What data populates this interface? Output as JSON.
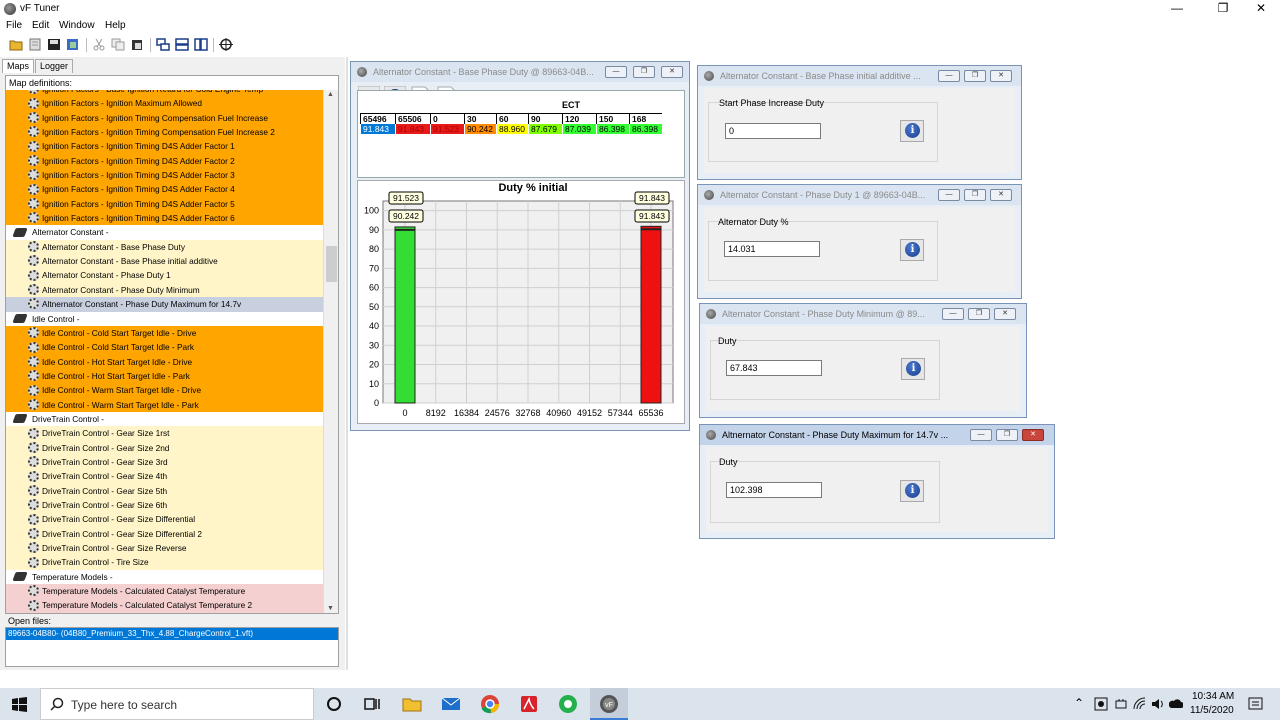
{
  "app": {
    "title": "vF Tuner"
  },
  "menu": {
    "file": "File",
    "edit": "Edit",
    "window": "Window",
    "help": "Help"
  },
  "left": {
    "tab_maps": "Maps",
    "tab_logger": "Logger",
    "caption": "Map definitions:",
    "open_files_label": "Open files:",
    "open_file": "89663-04B80- (04B80_Premium_33_Thx_4.88_ChargeControl_1.vft)"
  },
  "tree": [
    {
      "kind": "child",
      "style": "cat-orange",
      "label": "Ignition Factors - Base Ignition Retard for Cold Engine Temp"
    },
    {
      "kind": "child",
      "style": "cat-orange",
      "label": "Ignition Factors - Ignition Maximum Allowed"
    },
    {
      "kind": "child",
      "style": "cat-orange",
      "label": "Ignition Factors - Ignition Timing Compensation Fuel Increase"
    },
    {
      "kind": "child",
      "style": "cat-orange",
      "label": "Ignition Factors - Ignition Timing Compensation Fuel Increase 2"
    },
    {
      "kind": "child",
      "style": "cat-orange",
      "label": "Ignition Factors - Ignition Timing D4S Adder Factor 1"
    },
    {
      "kind": "child",
      "style": "cat-orange",
      "label": "Ignition Factors - Ignition Timing D4S Adder Factor 2"
    },
    {
      "kind": "child",
      "style": "cat-orange",
      "label": "Ignition Factors - Ignition Timing D4S Adder Factor 3"
    },
    {
      "kind": "child",
      "style": "cat-orange",
      "label": "Ignition Factors - Ignition Timing D4S Adder Factor 4"
    },
    {
      "kind": "child",
      "style": "cat-orange",
      "label": "Ignition Factors - Ignition Timing D4S Adder Factor 5"
    },
    {
      "kind": "child",
      "style": "cat-orange",
      "label": "Ignition Factors - Ignition Timing D4S Adder Factor 6"
    },
    {
      "kind": "group",
      "style": "group",
      "label": "Alternator Constant -"
    },
    {
      "kind": "child",
      "style": "cat-yellow",
      "label": "Alternator Constant - Base Phase Duty"
    },
    {
      "kind": "child",
      "style": "cat-yellow",
      "label": "Alternator Constant - Base Phase initial additive"
    },
    {
      "kind": "child",
      "style": "cat-yellow",
      "label": "Alternator Constant - Phase Duty 1"
    },
    {
      "kind": "child",
      "style": "cat-yellow",
      "label": "Alternator Constant - Phase Duty Minimum"
    },
    {
      "kind": "child",
      "style": "cat-sel",
      "label": "Altnernator Constant - Phase Duty Maximum for 14.7v"
    },
    {
      "kind": "group",
      "style": "group",
      "label": "Idle Control -"
    },
    {
      "kind": "child",
      "style": "cat-orange",
      "label": "Idle Control - Cold Start Target Idle - Drive"
    },
    {
      "kind": "child",
      "style": "cat-orange",
      "label": "Idle Control - Cold Start Target Idle - Park"
    },
    {
      "kind": "child",
      "style": "cat-orange",
      "label": "Idle Control - Hot Start Target Idle - Drive"
    },
    {
      "kind": "child",
      "style": "cat-orange",
      "label": "Idle Control - Hot Start Target Idle - Park"
    },
    {
      "kind": "child",
      "style": "cat-orange",
      "label": "Idle Control - Warm Start Target Idle - Drive"
    },
    {
      "kind": "child",
      "style": "cat-orange",
      "label": "Idle Control - Warm Start Target Idle - Park"
    },
    {
      "kind": "group",
      "style": "group",
      "label": "DriveTrain Control -"
    },
    {
      "kind": "child",
      "style": "cat-yellow",
      "label": "DriveTrain Control - Gear Size 1rst"
    },
    {
      "kind": "child",
      "style": "cat-yellow",
      "label": "DriveTrain Control - Gear Size 2nd"
    },
    {
      "kind": "child",
      "style": "cat-yellow",
      "label": "DriveTrain Control - Gear Size 3rd"
    },
    {
      "kind": "child",
      "style": "cat-yellow",
      "label": "DriveTrain Control - Gear Size 4th"
    },
    {
      "kind": "child",
      "style": "cat-yellow",
      "label": "DriveTrain Control - Gear Size 5th"
    },
    {
      "kind": "child",
      "style": "cat-yellow",
      "label": "DriveTrain Control - Gear Size 6th"
    },
    {
      "kind": "child",
      "style": "cat-yellow",
      "label": "DriveTrain Control - Gear Size Differential"
    },
    {
      "kind": "child",
      "style": "cat-yellow",
      "label": "DriveTrain Control - Gear Size Differential 2"
    },
    {
      "kind": "child",
      "style": "cat-yellow",
      "label": "DriveTrain Control - Gear Size Reverse"
    },
    {
      "kind": "child",
      "style": "cat-yellow",
      "label": "DriveTrain Control - Tire Size"
    },
    {
      "kind": "group",
      "style": "group",
      "label": "Temperature Models -"
    },
    {
      "kind": "child",
      "style": "cat-pink",
      "label": "Temperature Models - Calculated Catalyst Temperature"
    },
    {
      "kind": "child",
      "style": "cat-pink",
      "label": "Temperature Models - Calculated Catalyst Temperature 2"
    }
  ],
  "win_base": {
    "title": "Alternator Constant - Base Phase Duty @ 89663-04B...",
    "axis_title": "ECT",
    "chart_title": "Duty % initial",
    "axis": [
      "65496",
      "65506",
      "0",
      "30",
      "60",
      "90",
      "120",
      "150",
      "168"
    ],
    "values": [
      "91.843",
      "91.843",
      "91.523",
      "90.242",
      "88.960",
      "87.679",
      "87.039",
      "86.398",
      "86.398"
    ],
    "value_colors": [
      "#0078d7",
      "#e81b1b",
      "#e81b1b",
      "#ff8c00",
      "#ffff00",
      "#7fff00",
      "#33ff33",
      "#33ff33",
      "#33ff33"
    ]
  },
  "chart_data": {
    "type": "bar",
    "title": "Duty % initial",
    "xlabel": "",
    "ylabel": "",
    "x_ticks": [
      "0",
      "8192",
      "16384",
      "24576",
      "32768",
      "40960",
      "49152",
      "57344",
      "65536"
    ],
    "y_ticks": [
      "0",
      "10",
      "20",
      "30",
      "40",
      "50",
      "60",
      "70",
      "80",
      "90",
      "100"
    ],
    "ylim": [
      0,
      105
    ],
    "bars": [
      {
        "x": 0,
        "value": 91.523,
        "color": "#33dd33",
        "labels": [
          "91.523",
          "90.242"
        ]
      },
      {
        "x": 65536,
        "value": 91.843,
        "color": "#ee1111",
        "labels": [
          "91.843",
          "91.843"
        ]
      }
    ]
  },
  "win_additive": {
    "title": "Alternator Constant - Base Phase initial additive ...",
    "group": "Start Phase Increase Duty",
    "value": "0"
  },
  "win_phase1": {
    "title": "Alternator Constant - Phase Duty 1 @ 89663-04B...",
    "group": "Alternator Duty %",
    "value": "14.031"
  },
  "win_min": {
    "title": "Alternator Constant - Phase Duty Minimum @ 89...",
    "group": "Duty",
    "value": "67.843"
  },
  "win_max": {
    "title": "Altnernator Constant - Phase Duty Maximum for 14.7v ...",
    "group": "Duty",
    "value": "102.398"
  },
  "taskbar": {
    "search_placeholder": "Type here to search",
    "time": "10:34 AM",
    "date": "11/5/2020"
  }
}
